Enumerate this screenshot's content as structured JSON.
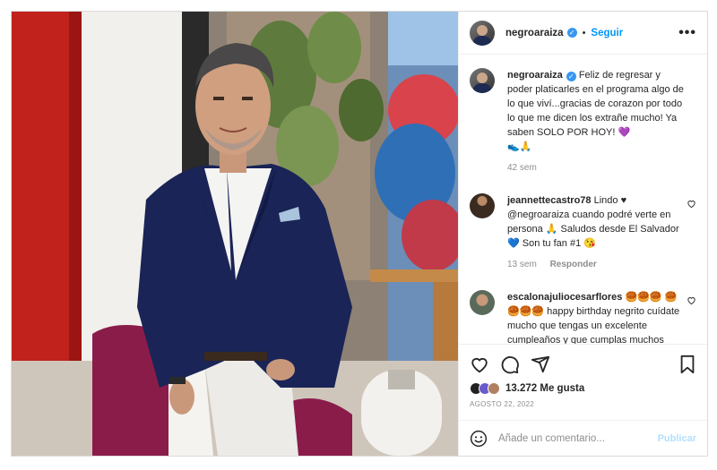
{
  "header": {
    "username": "negroaraiza",
    "dot": "•",
    "follow_label": "Seguir",
    "more_label": "•••"
  },
  "caption": {
    "username": "negroaraiza",
    "text": "Feliz de regresar y poder platicarles en el programa algo de lo que viví...gracias de corazon por todo lo que me dicen los extrañe mucho! Ya saben SOLO POR HOY! 💜",
    "emoji_line": "👟🙏",
    "time": "42 sem"
  },
  "comments": [
    {
      "username": "jeannettecastro78",
      "text": "Lindo ♥ @negroaraiza cuando podré verte en persona 🙏 Saludos desde El Salvador 💙 Son tu fan #1 😘",
      "time": "13 sem",
      "reply_label": "Responder"
    },
    {
      "username": "escalonajuliocesarflores",
      "text": "🥮🥮🥮 🥮🥮🥮🥮 happy birthday negrito cuídate mucho que tengas un excelente cumpleaños y que cumplas muchos años más un"
    }
  ],
  "likes": {
    "count_label": "13.272 Me gusta",
    "avatar_colors": [
      "#222222",
      "#6a5acd",
      "#b08060"
    ]
  },
  "date": "AGOSTO 22, 2022",
  "add_comment": {
    "placeholder": "Añade un comentario...",
    "publish_label": "Publicar"
  },
  "colors": {
    "accent": "#0095f6",
    "verified": "#3897f0",
    "muted": "#8e8e8e",
    "publish_disabled": "#b2dffc"
  },
  "icons": {
    "verified": "check-badge",
    "like": "heart-icon",
    "comment": "comment-icon",
    "share": "send-icon",
    "save": "bookmark-icon",
    "emoji": "smiley-icon"
  }
}
